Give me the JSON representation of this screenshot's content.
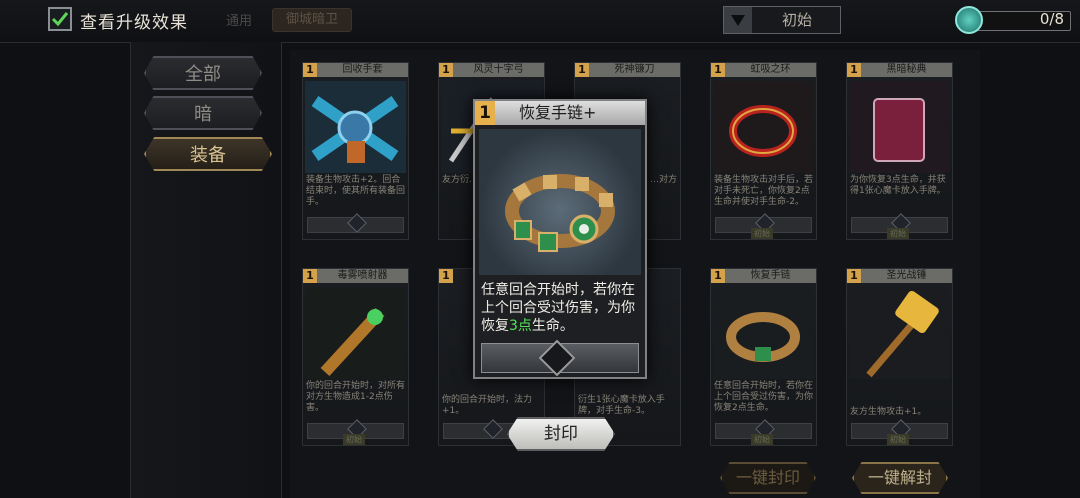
{
  "header": {
    "show_upgrade_label": "查看升级效果",
    "tab_general": "通用",
    "tab_guard": "御城暗卫",
    "dropdown_value": "初始",
    "counter_text": "0/8"
  },
  "sidebar": {
    "items": [
      {
        "label": "全部"
      },
      {
        "label": "暗"
      },
      {
        "label": "装备"
      }
    ]
  },
  "cards": [
    {
      "cost": "1",
      "name": "回收手套",
      "desc": "装备生物攻击+2。回合结束时，使其所有装备回手。",
      "tag": "初始"
    },
    {
      "cost": "1",
      "name": "风灵十字弓",
      "desc": "友方衍…使对手…",
      "tag": ""
    },
    {
      "cost": "1",
      "name": "死神镰刀",
      "desc": "…主动技…技能：…对方对峙",
      "tag": ""
    },
    {
      "cost": "1",
      "name": "虹吸之环",
      "desc": "装备生物攻击对手后，若对手未死亡，你恢复2点生命并使对手生命-2。",
      "tag": "初始"
    },
    {
      "cost": "1",
      "name": "黑暗秘典",
      "desc": "为你恢复3点生命，并获得1张心魔卡放入手牌。",
      "tag": "初始"
    },
    {
      "cost": "1",
      "name": "毒雾喷射器",
      "desc": "你的回合开始时，对所有对方生物造成1-2点伤害。",
      "tag": "初始"
    },
    {
      "cost": "1",
      "name": "",
      "desc": "你的回合开始时，法力+1。",
      "tag": "初始"
    },
    {
      "cost": "1",
      "name": "",
      "desc": "衍生1张心魔卡放入手牌，对手生命-3。",
      "tag": "初始"
    },
    {
      "cost": "1",
      "name": "恢复手链",
      "desc": "任意回合开始时，若你在上个回合受过伤害，为你恢复2点生命。",
      "tag": "初始"
    },
    {
      "cost": "1",
      "name": "圣光战锤",
      "desc": "友方生物攻击+1。",
      "tag": "初始"
    }
  ],
  "popup": {
    "cost": "1",
    "title": "恢复手链+",
    "text_before": "任意回合开始时，若你在上个回合受过伤害，为你恢复",
    "text_highlight": "3点",
    "text_after": "生命。"
  },
  "buttons": {
    "seal": "封印",
    "seal_all": "一键封印",
    "unseal_all": "一键解封"
  }
}
